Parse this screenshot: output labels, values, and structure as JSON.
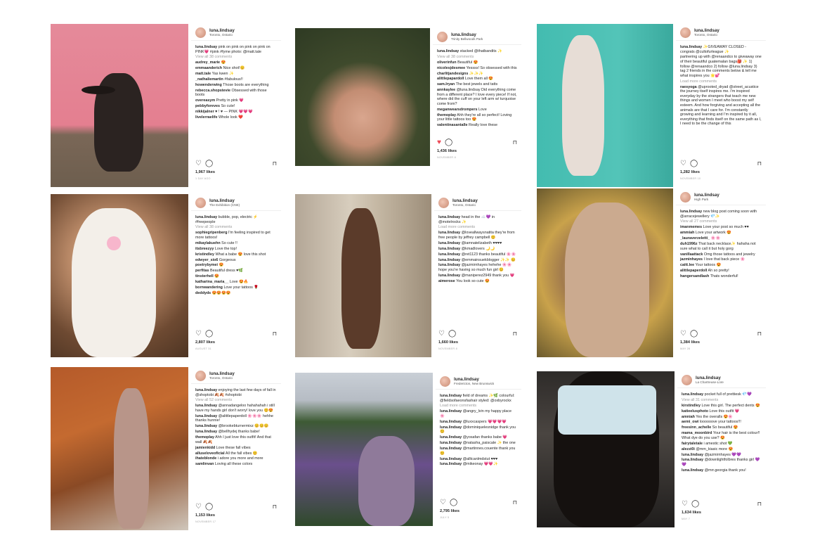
{
  "posts": [
    {
      "username": "luna.lindsay",
      "location": "Toronto, Ontario",
      "comments": [
        {
          "user": "luna.lindsay",
          "text": "pink on pink on pink on pink on PINK💗 #pink #fyme photo: @matt.tale"
        },
        {
          "user": "",
          "text": "View all 38 comments",
          "muted": true
        },
        {
          "user": "audrey_marie",
          "text": "😍"
        },
        {
          "user": "emmaanderich",
          "text": "Nice shot!😊"
        },
        {
          "user": "matt.tale",
          "text": "Yas kwen ✨"
        },
        {
          "user": "_nathaliemartin",
          "text": "#fabulous!!"
        },
        {
          "user": "howenderwing",
          "text": "Those boots are everything"
        },
        {
          "user": "rebecca.shopstevie",
          "text": "Obsessed with those boots"
        },
        {
          "user": "overeasym",
          "text": "Pretty in pink 💗"
        },
        {
          "user": "pebbyforeves",
          "text": "So cute!"
        },
        {
          "user": "nikkijalner",
          "text": "♥ ! ♥ — PINK 💗💗💗"
        },
        {
          "user": "livelerraelife",
          "text": "Whole look ❤️"
        }
      ],
      "liked": false,
      "likes": "1,967 likes",
      "date": "1 DAY AGO"
    },
    {
      "username": "luna.lindsay",
      "location": "Trinity Bellwoods Park",
      "comments": [
        {
          "user": "luna.lindsay",
          "text": "stacked @thatbandits ✨"
        },
        {
          "user": "",
          "text": "View all 38 comments",
          "muted": true
        },
        {
          "user": "oliverinfun",
          "text": "Beautiful 😍"
        },
        {
          "user": "nicolesjdesmee",
          "text": "Yessss! So obsessed with this"
        },
        {
          "user": "charlitjandesigns",
          "text": "✨✨✨"
        },
        {
          "user": "alittlepapardoll",
          "text": "Love them all 😍"
        },
        {
          "user": "sam.lryan",
          "text": "The best jewels and tatts"
        },
        {
          "user": "annkaylee",
          "text": "@luna.lindsay Did everything come from a different place? I love every piece! If not, where did the cuff on your left arm w/ turquoise come from?"
        },
        {
          "user": "meganwearsdrompers",
          "text": "Love"
        },
        {
          "user": "themoplay",
          "text": "Ahh they're all so perfect! Loving your little tattoos too 😍"
        },
        {
          "user": "valentinasantalle",
          "text": "Really love these"
        }
      ],
      "liked": true,
      "likes": "1,436 likes",
      "date": "NOVEMBER 8"
    },
    {
      "username": "luna.lindsay",
      "location": "Toronto, Ontario",
      "comments": [
        {
          "user": "luna.lindsay",
          "text": "✨GIVEAWAY CLOSED - congrats @cultofurleague ✨"
        },
        {
          "user": "",
          "text": "partnering up with @renaandco to giveaway one of their beautiful guatemalan bags🎒 ✨ 1) follow @renaandco 2) follow @luna.lindsay 3) tag 2 friends in the comments below & tell me what inspires you 🌟💕"
        },
        {
          "user": "",
          "text": "Load more comments",
          "muted": true
        },
        {
          "user": "raesyoga",
          "text": "@uprooted_dryad @street_acustice the journey itself inspires me. I'm inspired everyday by the strangers that teach me new things and women I meet who boost my self esteem. And how forgiving and accepting all the animals are that I care for. I'm constantly growing and learning and I'm inspired by it all, everything that finds itself on the same path as I, I need to be the change of this"
        }
      ],
      "liked": false,
      "likes": "1,282 likes",
      "date": "NOVEMBER 10"
    },
    {
      "username": "luna.lindsay",
      "location": "The Exhibition (CNE)",
      "comments": [
        {
          "user": "luna.lindsay",
          "text": "bubble, pop, electric ⚡ #freepeople"
        },
        {
          "user": "",
          "text": "View all 38 comments",
          "muted": true
        },
        {
          "user": "sophiegripenberg",
          "text": "I'm feeling inspired to get more tattoos!"
        },
        {
          "user": "mikaylakuehn",
          "text": "So cute !!"
        },
        {
          "user": "itsbreezyy",
          "text": "Love the top!"
        },
        {
          "user": "kristindley",
          "text": "What a babe 😍 love this shot"
        },
        {
          "user": "edwyer_sio6",
          "text": "Gorgeous"
        },
        {
          "user": "poetrybymei",
          "text": "😍"
        },
        {
          "user": "perfitas",
          "text": "Beautiful dress ♥🌿"
        },
        {
          "user": "tinsterhell",
          "text": "😍"
        },
        {
          "user": "katharina_maria__",
          "text": "Love 😍🔥"
        },
        {
          "user": "bornwandering",
          "text": "Love your tattoos 🌹"
        },
        {
          "user": "deddyds",
          "text": "😍😍😍😍"
        }
      ],
      "liked": false,
      "likes": "2,807 likes",
      "date": "AUGUST 31"
    },
    {
      "username": "luna.lindsay",
      "location": "Toronto, Ontario",
      "comments": [
        {
          "user": "luna.lindsay",
          "text": "head in the ☁️💜 in @motelrocks ✨"
        },
        {
          "user": "",
          "text": "Load more comments",
          "muted": true
        },
        {
          "user": "luna.lindsay",
          "text": "@loveallwaysnatita they're from free people by jeffrey campbell 😊"
        },
        {
          "user": "luna.lindsay",
          "text": "@iamnatelizabeth ♥♥♥♥"
        },
        {
          "user": "luna.lindsay",
          "text": "@kmadlovers 🌙🌙"
        },
        {
          "user": "luna.lindsay",
          "text": "@ret1123 thanks beautiful 🌸🌸"
        },
        {
          "user": "luna.lindsay",
          "text": "@emmainsuekblogger ✨✨ 😊"
        },
        {
          "user": "luna.lindsay",
          "text": "@jazmirnhayes hehehe 🌸🌸 hope you're having so much fun girl 😊"
        },
        {
          "user": "luna.lindsay",
          "text": "@maniperez2949 thank you 💗"
        },
        {
          "user": "aimerose",
          "text": "You look so cute 😍"
        }
      ],
      "liked": false,
      "likes": "1,660 likes",
      "date": "NOVEMBER 8"
    },
    {
      "username": "luna.lindsay",
      "location": "High Park",
      "comments": [
        {
          "user": "luna.lindsay",
          "text": "new blog post coming soon with @arracejewellery 💎✨"
        },
        {
          "user": "",
          "text": "View all 27 comments",
          "muted": true
        },
        {
          "user": "imanmemes",
          "text": "Love your post so much ♥♥"
        },
        {
          "user": "ammiah",
          "text": "Love your artwork 😍"
        },
        {
          "user": "_lauraverzeletti_",
          "text": "🌸🌸"
        },
        {
          "user": "duh1996z",
          "text": "That back necklace✨ hahaha not sure what to call it but holy gorg"
        },
        {
          "user": "vanillaattack",
          "text": "Omg those tattoos and jewelry"
        },
        {
          "user": "jazminhayes",
          "text": "I love that back piece 🌸"
        },
        {
          "user": "caitt.lee",
          "text": "Your tattoos 😍"
        },
        {
          "user": "alittlepaperdoll",
          "text": "Ah so pretty!"
        },
        {
          "user": "hangersandlash",
          "text": "Thats wonderful!"
        }
      ],
      "liked": false,
      "likes": "1,384 likes",
      "date": "MAY 28"
    },
    {
      "username": "luna.lindsay",
      "location": "Toronto, Ontario",
      "comments": [
        {
          "user": "luna.lindsay",
          "text": "enjoying the last few days of fall in @shoptobi 🍂🍂 #shoptobi"
        },
        {
          "user": "",
          "text": "View all 52 comments",
          "muted": true
        },
        {
          "user": "luna.lindsay",
          "text": "@annadangeloo hahahahah i still have my hands girl don't worry! love you 😊😍"
        },
        {
          "user": "luna.lindsay",
          "text": "@alittlepaperdoll 🌸🌸🌸 hehhe thanks hunnie!"
        },
        {
          "user": "luna.lindsay",
          "text": "@brookebturnermixz 😊😊😊"
        },
        {
          "user": "luna.lindsay",
          "text": "@bellhydej thanks babe!"
        },
        {
          "user": "themoplay",
          "text": "Ahh I just love this outfit! And that wall 🍂🍂"
        },
        {
          "user": "jamienkidd",
          "text": "Love these fall vibes"
        },
        {
          "user": "alluseloveoficial",
          "text": "All the fall vibes 😊"
        },
        {
          "user": "ihateblonde",
          "text": "i adore you more and more"
        },
        {
          "user": "samlinvan",
          "text": "Loving all these colors"
        }
      ],
      "liked": false,
      "likes": "1,153 likes",
      "date": "NOVEMBER 17"
    },
    {
      "username": "luna.lindsay",
      "location": "Fredericton, New Brunswick",
      "comments": [
        {
          "user": "luna.lindsay",
          "text": "field of dreams ✨🌿 colourful: @fieldsofaeonsfashair styled: @oxbyrockx"
        },
        {
          "user": "",
          "text": "Load more comments",
          "muted": true
        },
        {
          "user": "luna.lindsay",
          "text": "@angry_lvin my happy place 🌸"
        },
        {
          "user": "luna.lindsay",
          "text": "@luxxcaspers 💗💗💗💗"
        },
        {
          "user": "luna.lindsay",
          "text": "@dominiquelesnidge thank you 😊"
        },
        {
          "user": "luna.lindsay",
          "text": "@yosafan thanks babe 💗"
        },
        {
          "user": "luna.lindsay",
          "text": "@natasha_paiscale ✨ the one"
        },
        {
          "user": "luna.lindsay",
          "text": "@martinnes.couente thank you 😊"
        },
        {
          "user": "luna.lindsay",
          "text": "@alltcanlmdstut ♥♥♥"
        },
        {
          "user": "luna.lindsay",
          "text": "@mikeonay 💗💗✨"
        }
      ],
      "liked": false,
      "likes": "2,795 likes",
      "date": "JULY 5"
    },
    {
      "username": "luna.lindsay",
      "location": "La Chartreuse-Lore",
      "comments": [
        {
          "user": "luna.lindsay",
          "text": "pocket full of prettiesk 💎💜"
        },
        {
          "user": "",
          "text": "View all 31 comments",
          "muted": true
        },
        {
          "user": "kirstindley",
          "text": "Love this girl. The perfect dents 😍"
        },
        {
          "user": "katieelusphoto",
          "text": "Love this outfit 💗"
        },
        {
          "user": "amniah",
          "text": "Yes the overalls 😍🌸"
        },
        {
          "user": "aemi_owi",
          "text": "loooooove your tattoos!!!"
        },
        {
          "user": "freesinn_achelle",
          "text": "So beautiful 😍"
        },
        {
          "user": "mama_moonbird",
          "text": "Your hair is the best colour!! What dye do you use? 😍"
        },
        {
          "user": "fairytaletale",
          "text": "i amestic shot 💚"
        },
        {
          "user": "alezzi0i",
          "text": "@mm_kiasic more 😍"
        },
        {
          "user": "luna.lindsay",
          "text": "@jazmirnhayes 💜💜"
        },
        {
          "user": "luna.lindsay",
          "text": "@downlightfolbres thanks girl 💜💜"
        },
        {
          "user": "luna.lindsay",
          "text": "@mrr.georgia thank you!"
        }
      ],
      "liked": false,
      "likes": "1,634 likes",
      "date": "MAY 7"
    }
  ],
  "icons": {
    "heart": "♡",
    "heart_filled": "♥",
    "comment": "◯",
    "save": "⊓"
  }
}
